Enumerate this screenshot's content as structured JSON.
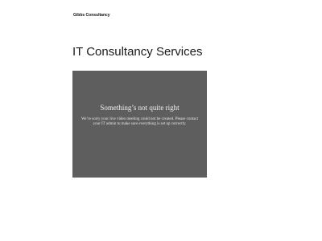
{
  "header": {
    "brand": "Gibbs Consultancy"
  },
  "main": {
    "title": "IT Consultancy Services"
  },
  "video_error": {
    "title": "Something’s not quite right",
    "message": "We’re sorry your live video meeting could not be created. Please contact your IT admin to make sure everything is set up correctly."
  },
  "colors": {
    "background": "#ffffff",
    "panel": "#5e5e5e",
    "panel_text": "#f2f2f2"
  }
}
